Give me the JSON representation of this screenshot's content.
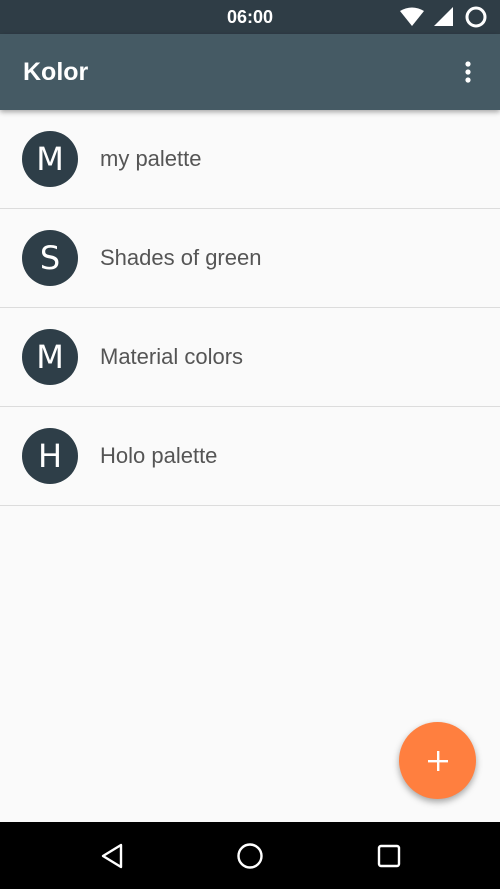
{
  "status_bar": {
    "time": "06:00",
    "icons": [
      "wifi-icon",
      "signal-icon",
      "battery-icon"
    ]
  },
  "app_bar": {
    "title": "Kolor",
    "overflow_icon": "more-vert-icon"
  },
  "palettes": [
    {
      "initial": "M",
      "name": "my palette"
    },
    {
      "initial": "S",
      "name": "Shades of green"
    },
    {
      "initial": "M",
      "name": "Material colors"
    },
    {
      "initial": "H",
      "name": "Holo palette"
    }
  ],
  "fab": {
    "icon": "plus-icon",
    "color": "#ff7f3f"
  },
  "nav_bar": {
    "icons": [
      "back-icon",
      "home-icon",
      "recents-icon"
    ]
  },
  "colors": {
    "status_bar": "#2f3d46",
    "app_bar": "#455a64",
    "avatar": "#2e3e48",
    "background": "#fafafa"
  }
}
